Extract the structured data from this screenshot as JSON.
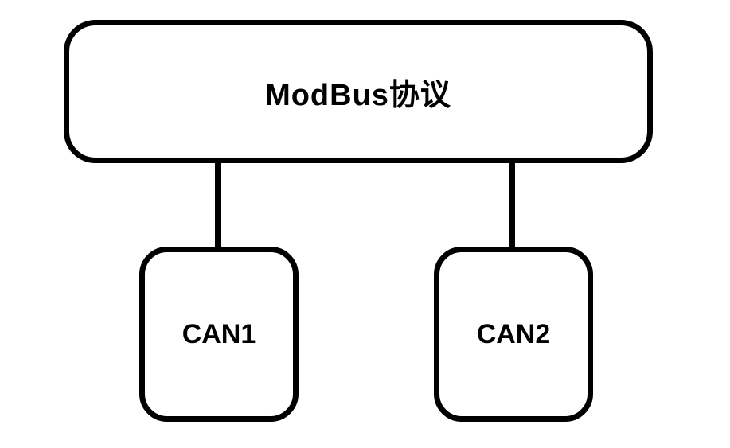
{
  "diagram": {
    "top_box": {
      "label": "ModBus协议"
    },
    "bottom_boxes": {
      "left": {
        "label": "CAN1"
      },
      "right": {
        "label": "CAN2"
      }
    }
  }
}
